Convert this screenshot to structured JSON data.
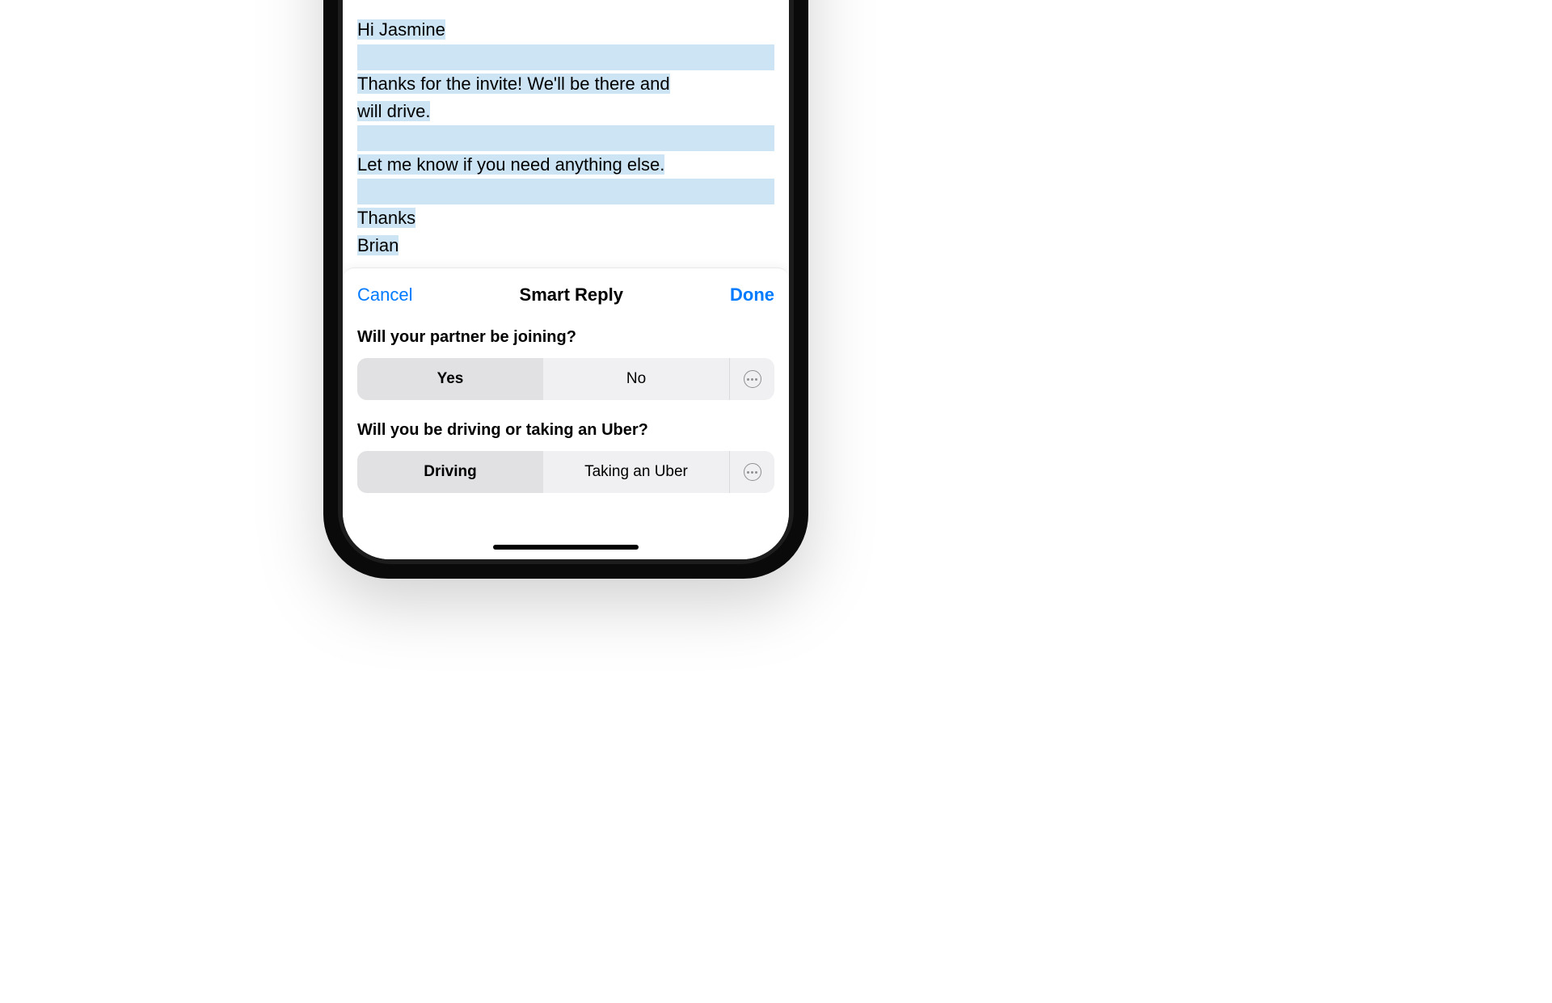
{
  "email": {
    "greeting": "Hi Jasmine",
    "line1": "Thanks for the invite! We'll be there and",
    "line2": "will drive.",
    "line3": "Let me know if you need anything else.",
    "closing1": "Thanks",
    "closing2": "Brian"
  },
  "sheet": {
    "cancel": "Cancel",
    "title": "Smart Reply",
    "done": "Done",
    "questions": [
      {
        "prompt": "Will your partner be joining?",
        "option_a": "Yes",
        "option_b": "No",
        "selected": "a"
      },
      {
        "prompt": "Will you be driving or taking an Uber?",
        "option_a": "Driving",
        "option_b": "Taking an Uber",
        "selected": "a"
      }
    ]
  }
}
